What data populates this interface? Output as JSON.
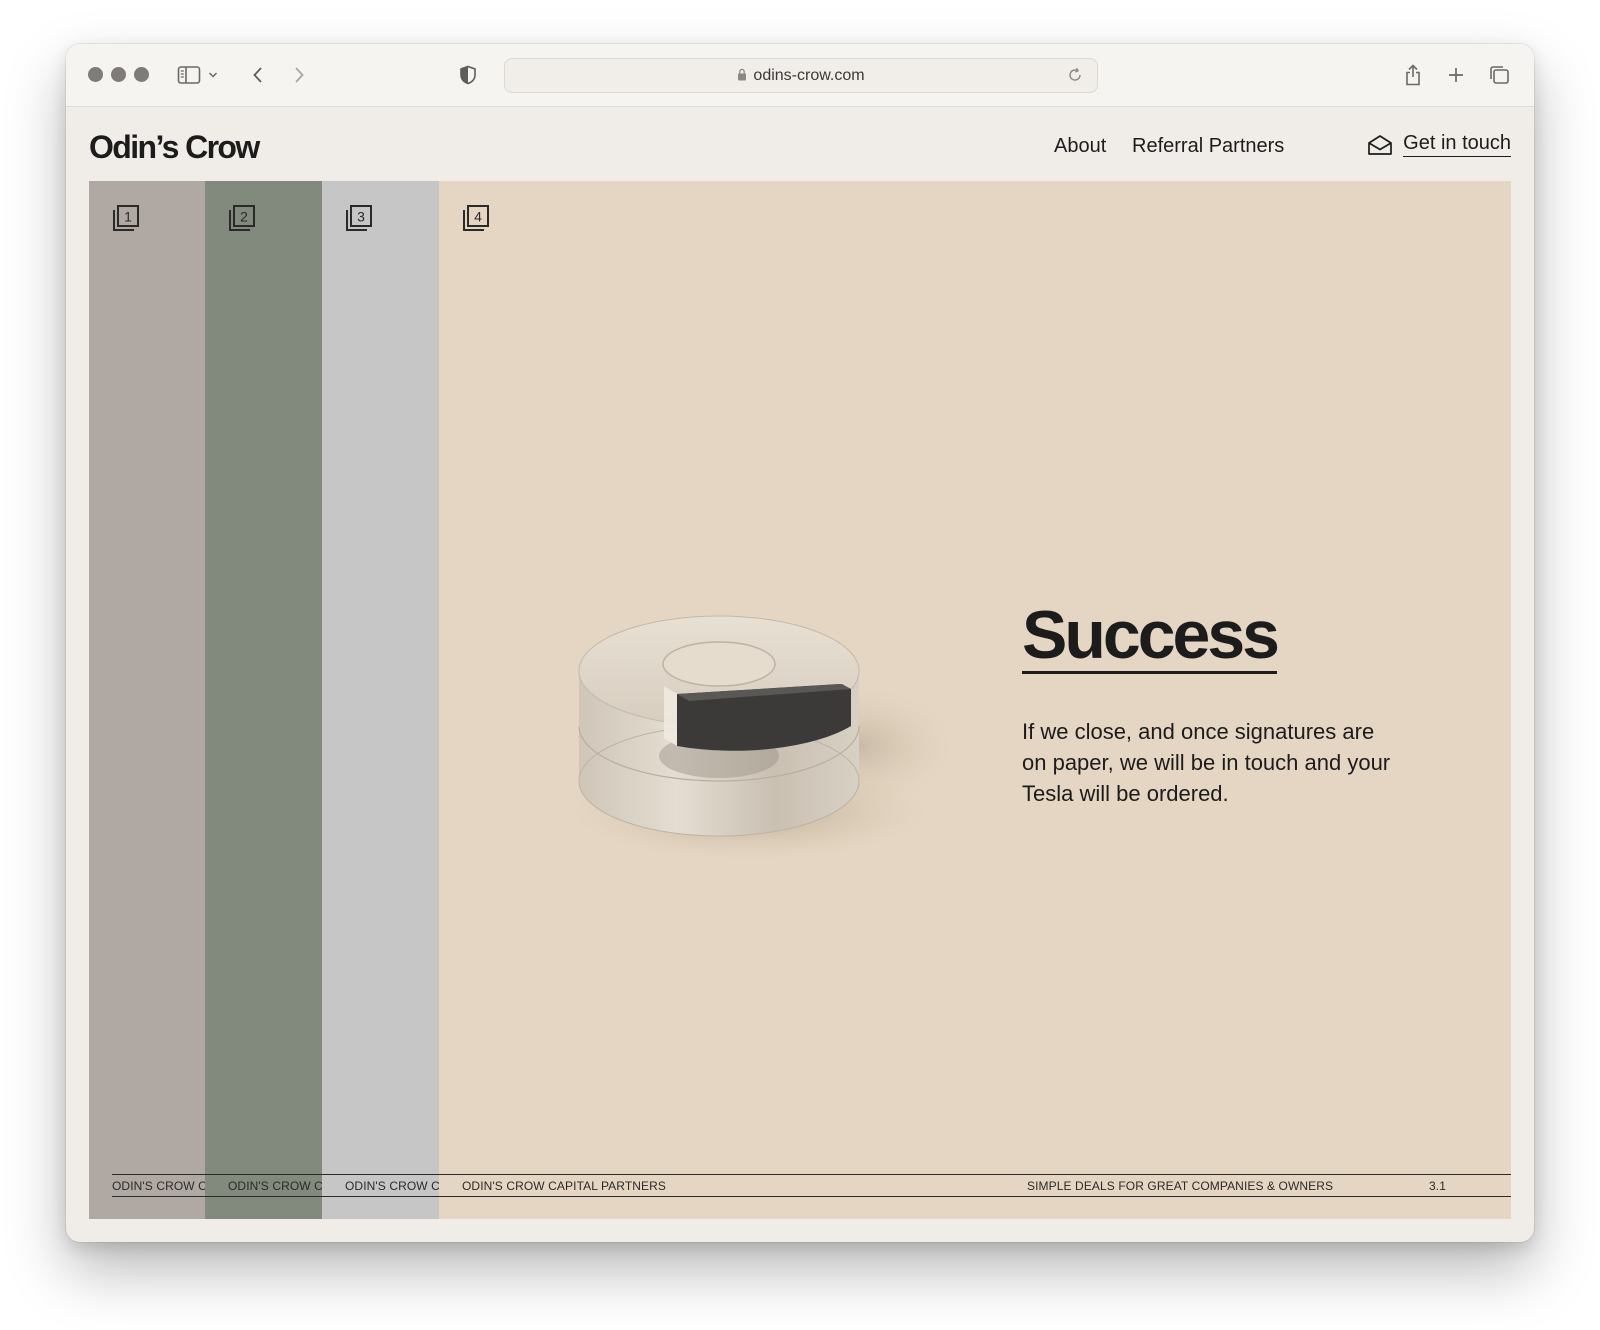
{
  "browser": {
    "url": "odins-crow.com"
  },
  "site": {
    "logo": "Odin’s Crow",
    "nav": {
      "about": "About",
      "referral": "Referral Partners",
      "cta": "Get in touch"
    }
  },
  "panels": [
    {
      "number": "1",
      "footer": "ODIN'S CROW CAPITAL PARTNERS",
      "color": "#b0a8a3"
    },
    {
      "number": "2",
      "footer": "ODIN'S CROW CAPITAL PARTNERS",
      "color": "#818a7d"
    },
    {
      "number": "3",
      "footer": "ODIN'S CROW CAPITAL PARTNERS",
      "color": "#c6c6c7"
    },
    {
      "number": "4",
      "footer": "ODIN'S CROW CAPITAL PARTNERS",
      "color": "#e5d6c3"
    }
  ],
  "active": {
    "headline": "Success",
    "body": "If we close, and once signatures are on paper, we will be in touch and your Tesla will be ordered.",
    "tagline": "SIMPLE DEALS FOR GREAT COMPANIES & OWNERS",
    "page": "3.1"
  },
  "colors": {
    "ink": "#1c1c1c",
    "header_bg": "#f0ede8"
  },
  "icons": {
    "sidebar": "sidebar-icon",
    "back": "chevron-left-icon",
    "forward": "chevron-right-icon",
    "shield": "shield-icon",
    "reload": "reload-icon",
    "share": "share-icon",
    "new_tab": "plus-icon",
    "tabs": "tabs-overview-icon",
    "mail": "envelope-icon"
  }
}
